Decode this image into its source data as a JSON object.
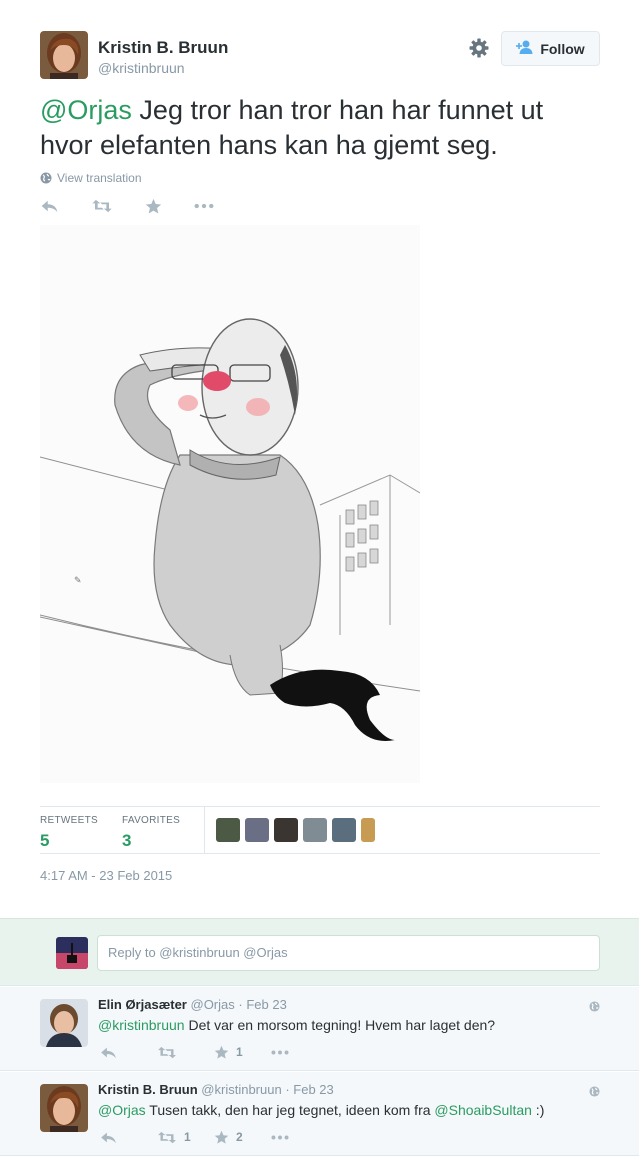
{
  "tweet": {
    "author_name": "Kristin B. Bruun",
    "author_handle": "@kristinbruun",
    "follow_label": "Follow",
    "text_mention": "@Orjas",
    "text_body": " Jeg tror han tror han har funnet ut hvor elefanten hans kan ha gjemt seg.",
    "view_translation": "View translation",
    "retweets_label": "RETWEETS",
    "retweets_count": "5",
    "favorites_label": "FAVORITES",
    "favorites_count": "3",
    "timestamp": "4:17 AM - 23 Feb 2015"
  },
  "reply_box": {
    "placeholder": "Reply to @kristinbruun @Orjas"
  },
  "replies": [
    {
      "name": "Elin Ørjasæter",
      "handle": "@Orjas",
      "date": "· Feb 23",
      "mention": "@kristinbruun",
      "text": " Det var en morsom tegning! Hvem har laget den?",
      "retweets": "",
      "favorites": "1"
    },
    {
      "name": "Kristin B. Bruun",
      "handle": "@kristinbruun",
      "date": "· Feb 23",
      "mention": "@Orjas",
      "text": " Tusen takk, den har jeg tegnet, ideen kom fra ",
      "mention2": "@ShoaibSultan",
      "text_end": " :)",
      "retweets": "1",
      "favorites": "2"
    }
  ],
  "colors": {
    "link_green": "#2a9c62",
    "muted": "#8899a6",
    "reply_bg": "#e8f3ed",
    "follow_icon_blue": "#55acee"
  },
  "icons": [
    "gear-icon",
    "follow-person-icon",
    "globe-icon",
    "reply-icon",
    "retweet-icon",
    "favorite-star-icon",
    "more-icon"
  ]
}
